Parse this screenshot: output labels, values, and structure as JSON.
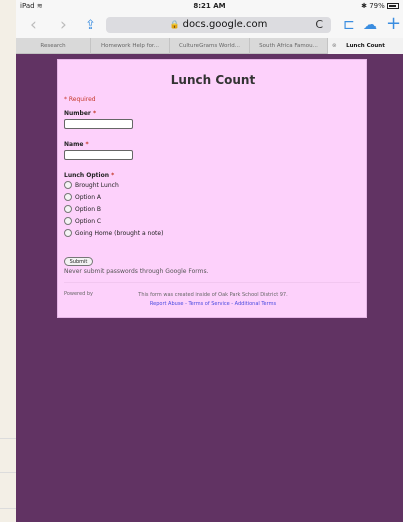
{
  "status_bar": {
    "device": "iPad",
    "wifi": "wifi-icon",
    "time": "8:21 AM",
    "bluetooth": "bluetooth-icon",
    "battery_text": "79%"
  },
  "toolbar": {
    "url": "docs.google.com",
    "back_icon": "‹",
    "forward_icon": "›",
    "share_icon": "⇪",
    "reload_icon": "C",
    "bookmarks_icon": "⊏",
    "cloud_icon": "☁",
    "plus_icon": "+"
  },
  "tabs": [
    {
      "label": "Research"
    },
    {
      "label": "Homework Help for..."
    },
    {
      "label": "CultureGrams World..."
    },
    {
      "label": "South Africa Famou..."
    },
    {
      "label": "Lunch Count",
      "active": true
    }
  ],
  "form": {
    "title": "Lunch Count",
    "required_note": "* Required",
    "questions": [
      {
        "label": "Number",
        "req": "*"
      },
      {
        "label": "Name",
        "req": "*"
      },
      {
        "label": "Lunch Option",
        "req": "*"
      }
    ],
    "options": [
      "Brought Lunch",
      "Option A",
      "Option B",
      "Option C",
      "Going Home (brought a note)"
    ],
    "submit_label": "Submit",
    "password_note": "Never submit passwords through Google Forms.",
    "powered_by": "Powered by",
    "created_note": "This form was created inside of Oak Park School District 97.",
    "footer_links": "Report Abuse - Terms of Service - Additional Terms"
  },
  "colors": {
    "page_background": "#613363",
    "form_background": "#fdd1fb",
    "required": "#c53929",
    "accent": "#3a8de0"
  }
}
